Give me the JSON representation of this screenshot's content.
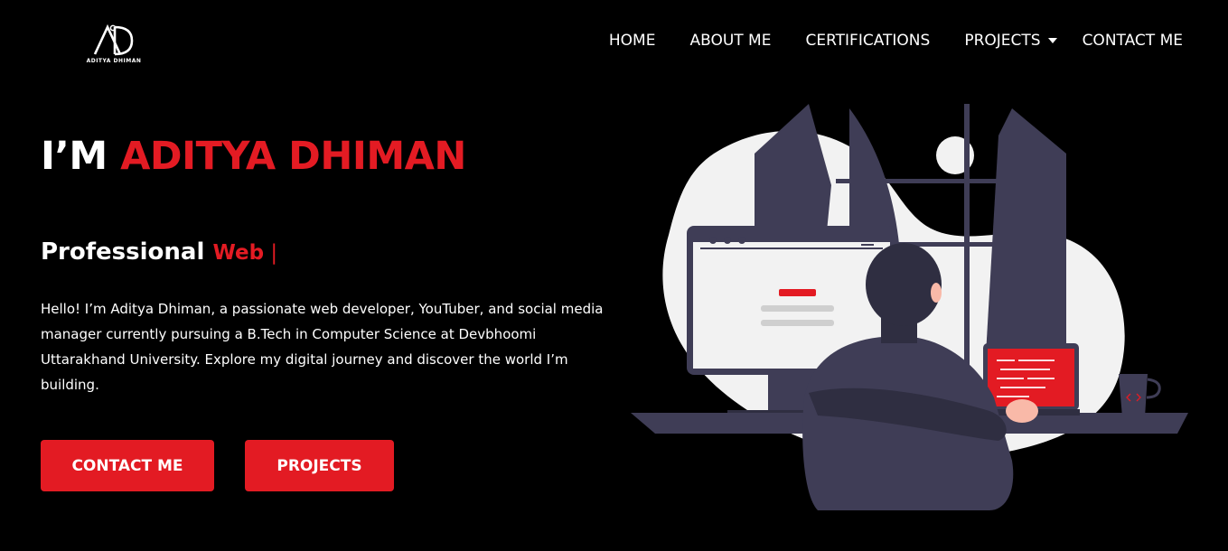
{
  "brand": {
    "logo_text": "ADITYA DHIMAN"
  },
  "nav": {
    "home": "HOME",
    "about": "ABOUT ME",
    "certifications": "CERTIFICATIONS",
    "projects": "PROJECTS",
    "contact": "CONTACT ME"
  },
  "hero": {
    "title_prefix": "I’M ",
    "title_name": "ADITYA DHIMAN",
    "subtitle_static": "Professional ",
    "subtitle_typed": "Web",
    "subtitle_cursor": " |",
    "intro": "Hello! I’m Aditya Dhiman, a passionate web developer, YouTuber, and social media manager currently pursuing a B.Tech in Computer Science at Devbhoomi Uttarakhand University. Explore my digital journey and discover the world I’m building."
  },
  "buttons": {
    "contact": "CONTACT ME",
    "projects": "PROJECTS"
  },
  "colors": {
    "accent": "#e31b23",
    "background": "#000000",
    "text": "#ffffff"
  },
  "icons": {
    "logo": "ad-monogram-logo",
    "dropdown": "caret-down-icon",
    "code": "code-brackets-icon"
  }
}
